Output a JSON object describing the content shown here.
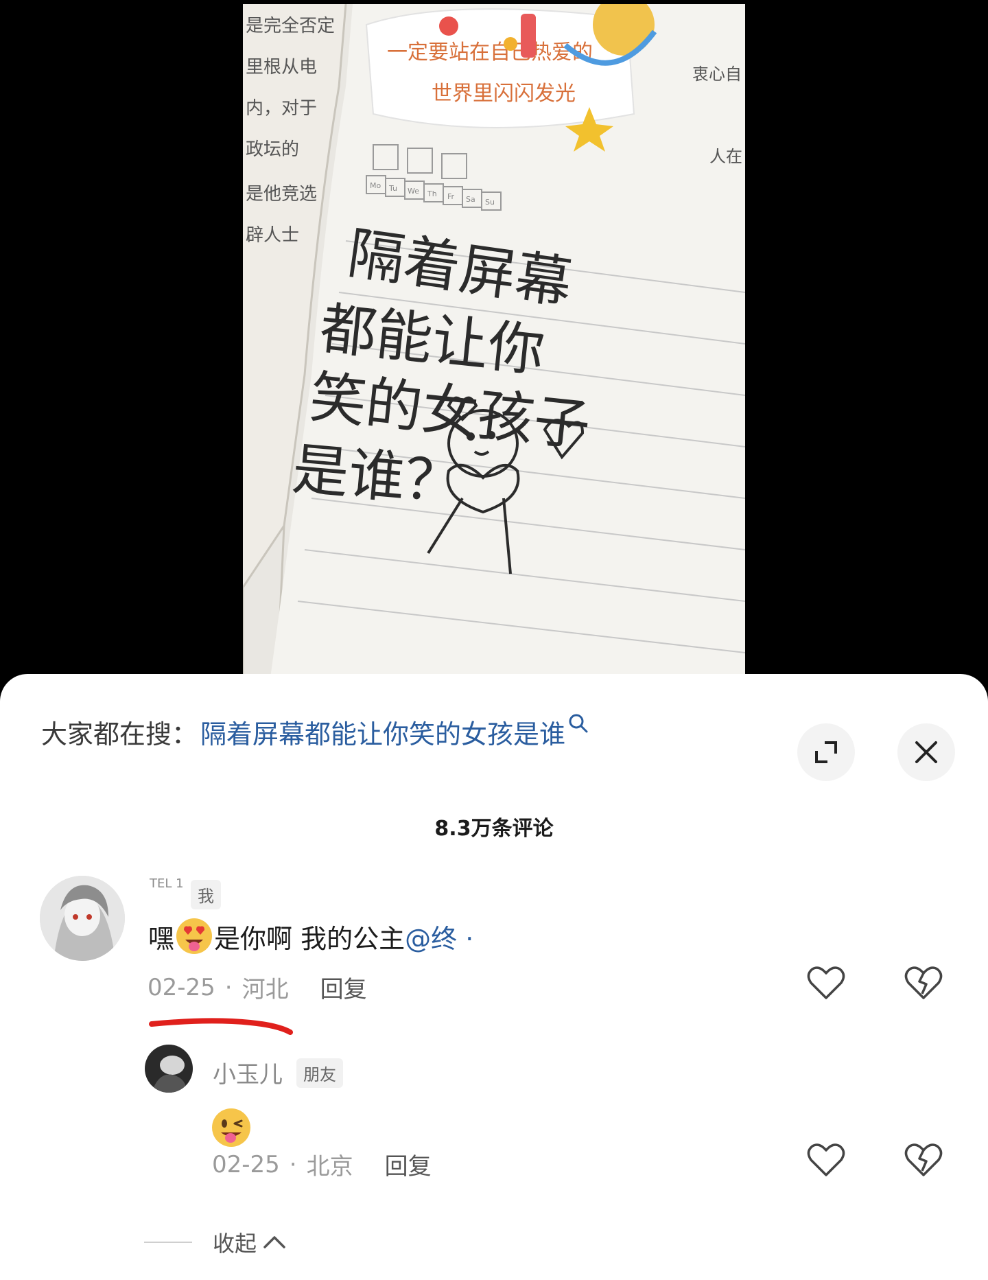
{
  "video": {
    "header_line1": "一定要站在自己热爱的",
    "header_line2": "世界里闪闪发光",
    "weekdays": [
      "Mo",
      "Tu",
      "We",
      "Th",
      "Fr",
      "Sa",
      "Su"
    ],
    "book_lines": [
      "是完全否定",
      "里根从电",
      "内，对于",
      "政坛的",
      "是他竞选",
      "辟人士"
    ],
    "book_right": [
      "衷心自",
      "人在"
    ],
    "handwriting": [
      "隔着屏幕",
      "都能让你",
      "笑的女孩子",
      "是谁？"
    ]
  },
  "panel": {
    "search_prefix": "大家都在搜：",
    "search_query": "隔着屏幕都能让你笑的女孩是谁",
    "comment_count": "8.3万条评论"
  },
  "comments": [
    {
      "username": "TEL 1",
      "tag": "我",
      "text_before": "嘿",
      "text_after": " 是你啊 我的公主",
      "mention": "@终 ·",
      "date": "02-25",
      "location": "河北",
      "reply_label": "回复",
      "emoji": "heart-eyes-tongue-emoji"
    }
  ],
  "replies": [
    {
      "username": "小玉儿",
      "tag": "朋友",
      "emoji": "wink-tongue-emoji",
      "date": "02-25",
      "location": "北京",
      "reply_label": "回复"
    }
  ],
  "collapse_label": "收起",
  "colors": {
    "link": "#2a5d9f",
    "red_mark": "#e0201c"
  }
}
